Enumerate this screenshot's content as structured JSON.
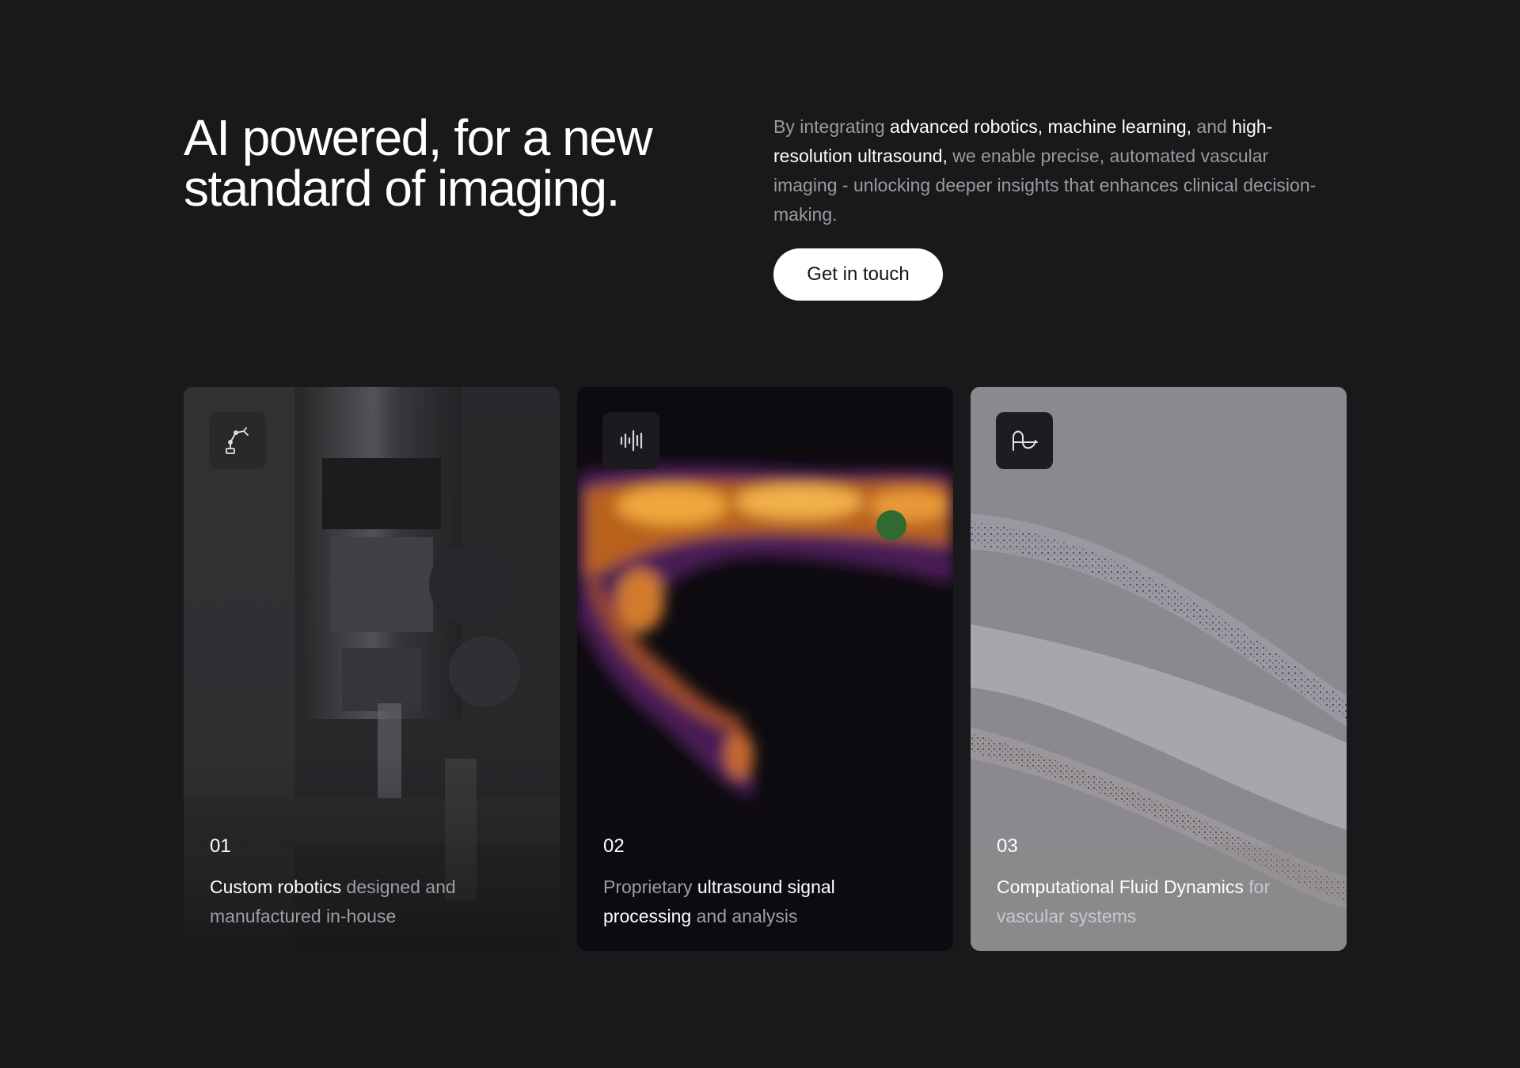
{
  "hero": {
    "title_line1": "AI powered, for a new",
    "title_line2": "standard of imaging.",
    "description": {
      "p1": "By integrating ",
      "h1": "advanced robotics, machine learning,",
      "p2": " and ",
      "h2": "high-resolution ultrasound,",
      "p3": " we enable precise, automated vascular imaging - unlocking deeper insights that enhances clinical decision-making."
    },
    "cta_label": "Get in touch"
  },
  "cards": [
    {
      "number": "01",
      "highlight": "Custom robotics",
      "rest": " designed and manufactured in-house",
      "icon": "robot-arm-icon"
    },
    {
      "number": "02",
      "pre": "Proprietary ",
      "highlight": "ultrasound signal processing",
      "rest": " and analysis",
      "icon": "waveform-icon"
    },
    {
      "number": "03",
      "highlight": "Computational Fluid Dynamics",
      "rest": " for vascular systems",
      "icon": "fluid-curve-icon"
    }
  ],
  "colors": {
    "background": "#19181b",
    "button_bg": "#ffffff",
    "muted_text": "#9b9a9e",
    "highlight_text": "#ffffff"
  }
}
